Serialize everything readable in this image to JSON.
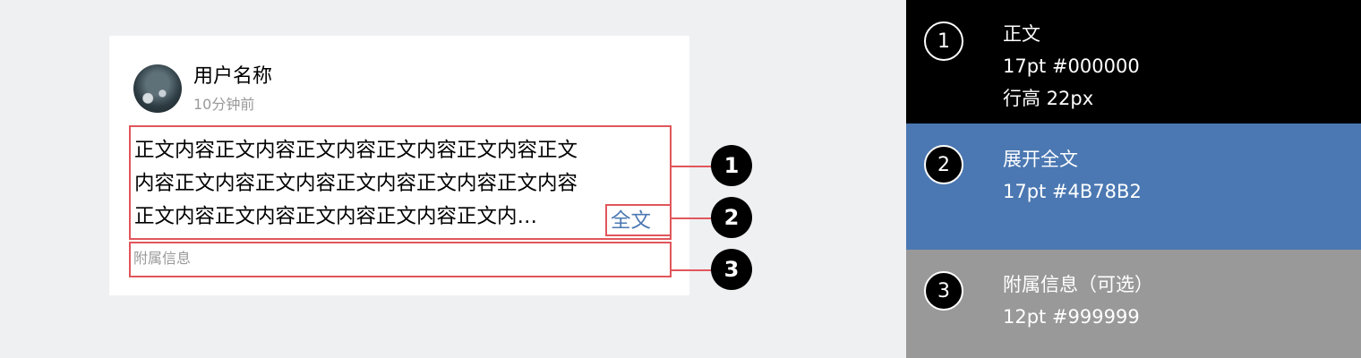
{
  "card": {
    "username": "用户名称",
    "time": "10分钟前",
    "body_lines": [
      "正文内容正文内容正文内容正文内容正文内容正文",
      "内容正文内容正文内容正文内容正文内容正文内容",
      "正文内容正文内容正文内容正文内容正文内…"
    ],
    "expand_label": "全文",
    "attachment": "附属信息"
  },
  "callouts": [
    "1",
    "2",
    "3"
  ],
  "legend": [
    {
      "number": "1",
      "title": "正文",
      "spec": "17pt #000000",
      "extra": "行高 22px",
      "color": "#000000"
    },
    {
      "number": "2",
      "title": "展开全文",
      "spec": "17pt #4B78B2",
      "color": "#4B78B2"
    },
    {
      "number": "3",
      "title": "附属信息（可选）",
      "spec": "12pt #999999",
      "color": "#999999"
    }
  ],
  "colors": {
    "accent": "#4B78B2",
    "annotation": "#e0565b",
    "background": "#eff0f2"
  }
}
